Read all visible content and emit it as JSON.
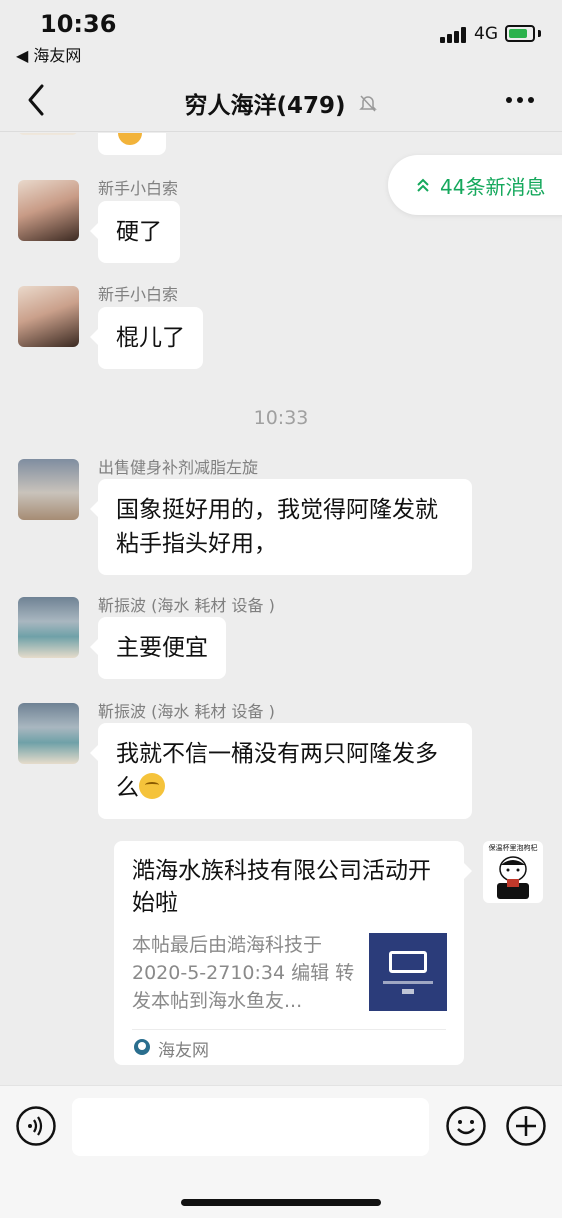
{
  "status_bar": {
    "time": "10:36",
    "back_app": "◀ 海友网",
    "network": "4G"
  },
  "nav": {
    "title": "穷人海洋(479)",
    "icons": [
      "back-chevron-icon",
      "mute-bell-icon",
      "more-dots-icon"
    ]
  },
  "new_messages": {
    "label": "44条新消息",
    "icon": "double-chevron-up-icon",
    "color": "#15a85c"
  },
  "messages": [
    {
      "sender": "新手小白索",
      "text": "硬了"
    },
    {
      "sender": "新手小白索",
      "text": "棍儿了"
    },
    {
      "sender": "出售健身补剂减脂左旋",
      "text": "国象挺好用的，我觉得阿隆发就粘手指头好用，"
    },
    {
      "sender": "靳振波 (海水 耗材 设备 )",
      "text": "主要便宜"
    },
    {
      "sender": "靳振波 (海水 耗材 设备 )",
      "text": "我就不信一桶没有两只阿隆发多么"
    }
  ],
  "time_divider": "10:33",
  "card": {
    "title": "澔海水族科技有限公司活动开始啦",
    "description": "本帖最后由澔海科技于2020-5-2710:34 编辑 转发本帖到海水鱼友...",
    "source": "海友网"
  },
  "self_avatar_caption": "保温杯里泡枸杞",
  "input_bar": {
    "icons": [
      "voice-icon",
      "emoji-icon",
      "plus-icon"
    ]
  },
  "colors": {
    "background": "#ededed",
    "bubble": "#ffffff",
    "accent_green": "#15a85c"
  }
}
